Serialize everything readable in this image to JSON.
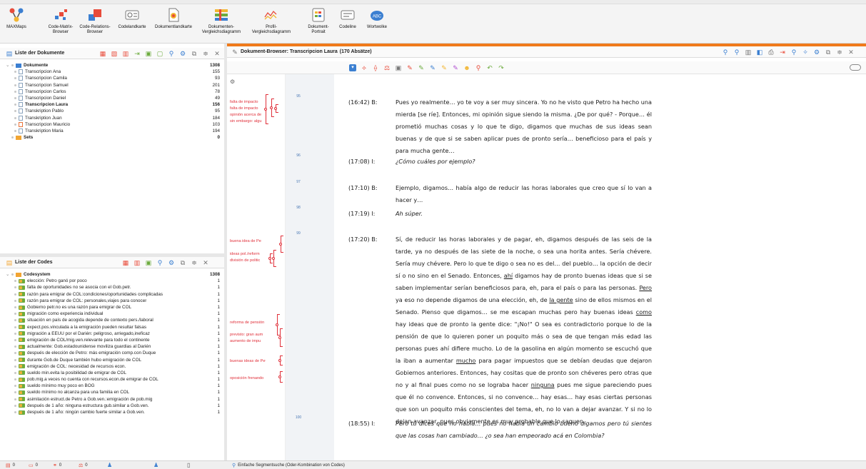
{
  "ribbon": {
    "buttons": [
      {
        "label": "MAXMaps",
        "icon": "maxmaps-icon"
      },
      {
        "label": "Code-Matrix-\nBrowser",
        "icon": "code-matrix-browser-icon"
      },
      {
        "label": "Code-Relations-\nBrowser",
        "icon": "code-relations-browser-icon"
      },
      {
        "label": "Codelandkarte",
        "icon": "codelandkarte-icon"
      },
      {
        "label": "Dokumentlandkarte",
        "icon": "dokumentlandkarte-icon"
      },
      {
        "label": "Dokumenten-\nVergleichsdiagramm",
        "icon": "dokumenten-vergleichsdiagramm-icon"
      },
      {
        "label": "Profil-\nVergleichsdiagramm",
        "icon": "profil-vergleichsdiagramm-icon"
      },
      {
        "label": "Dokument-\nPortrait",
        "icon": "dokument-portrait-icon"
      },
      {
        "label": "Codeline",
        "icon": "codeline-icon"
      },
      {
        "label": "Wortwolke",
        "icon": "wortwolke-icon"
      }
    ]
  },
  "docs_panel": {
    "title": "Liste der Dokumente",
    "root": {
      "label": "Dokumente",
      "count": "1308"
    },
    "items": [
      {
        "label": "Transcripcion Ana",
        "count": "155"
      },
      {
        "label": "Transcripcion Camila",
        "count": "93"
      },
      {
        "label": "Transcripcion Samuel",
        "count": "201"
      },
      {
        "label": "Transcripcion Carlos",
        "count": "78"
      },
      {
        "label": "Transcripcion Daniel",
        "count": "49"
      },
      {
        "label": "Transcripcion Laura",
        "count": "156"
      },
      {
        "label": "Transkription Pablo",
        "count": "95"
      },
      {
        "label": "Transkription Juan",
        "count": "184"
      },
      {
        "label": "Transcripcion Mauricio",
        "count": "103"
      },
      {
        "label": "Transkription Maria",
        "count": "194"
      }
    ],
    "sets": {
      "label": "Sets",
      "count": "0"
    }
  },
  "codes_panel": {
    "title": "Liste der Codes",
    "root": {
      "label": "Codesystem",
      "count": "1308"
    },
    "items": [
      {
        "label": "elección: Petro ganó por poco",
        "count": "1"
      },
      {
        "label": "falta de oportunidades no se asocia con el Gob.petr.",
        "count": "1"
      },
      {
        "label": "razón para emigrar de COL:condiciones/oportunidades complicadas",
        "count": "1"
      },
      {
        "label": "razón para emigrar de COL: personales,viajes para conocer",
        "count": "1"
      },
      {
        "label": "Gobierno petr.no es una razón para emigrar de COL",
        "count": "1"
      },
      {
        "label": "migración como experiencia individual",
        "count": "1"
      },
      {
        "label": "situación en país de acogida depende de contexto pers./laboral",
        "count": "1"
      },
      {
        "label": "expect.pos.vinculada a la emigración pueden resultar falsas",
        "count": "1"
      },
      {
        "label": "migración a EEUU por el Darién: peligroso, arriegado,ineficaz",
        "count": "1"
      },
      {
        "label": "emigración de COL/mig.ven.relevante para todo el continente",
        "count": "1"
      },
      {
        "label": "actualmente: Gob.estadounidense moviliza guardias al Darién",
        "count": "1"
      },
      {
        "label": "después de elección de Petro: más emigración comp.con Duque",
        "count": "1"
      },
      {
        "label": "durante Gob.de Duque también hubo emigración de COL",
        "count": "1"
      },
      {
        "label": "emigración de COL: necesidad de recursos econ.",
        "count": "1"
      },
      {
        "label": "sueldo min.evita la posibilidad de emigrar de COL",
        "count": "1"
      },
      {
        "label": "pob.mig.a veces no cuenta con recursos.econ.de emigrar de COL",
        "count": "1"
      },
      {
        "label": "sueldo mínimo muy poco en BOG",
        "count": "1"
      },
      {
        "label": "sueldo mínimo no alcanza para una familia en COL",
        "count": "1"
      },
      {
        "label": "asimilación estruct.de Petro a Gob.ven.:emigración de pob.mig",
        "count": "1"
      },
      {
        "label": "después de 1 año: ninguna estructura gub.similar a Gob.ven.",
        "count": "1"
      },
      {
        "label": "después de 1 año: ningún cambio fuerte similar a Gob.ven.",
        "count": "1"
      }
    ]
  },
  "browser": {
    "title": "Dokument-Browser: Transcripcion Laura",
    "count": "(170 Absätze)"
  },
  "code_labels": [
    {
      "text": "falta de impacto"
    },
    {
      "text": "falta de impacto"
    },
    {
      "text": "opinión acerca de"
    },
    {
      "text": "sin embargo: algu"
    },
    {
      "text": "buena idea de Pe"
    },
    {
      "text": "ideas pol./reform"
    },
    {
      "text": "división de politic"
    },
    {
      "text": "reforma de pensión"
    },
    {
      "text": "previsto: gran aum"
    },
    {
      "text": "aumento de impu"
    },
    {
      "text": "buenas ideas de Petro"
    },
    {
      "text": "oposición frenando"
    }
  ],
  "paragraphs": [
    {
      "num": "95",
      "ts": "(16:42) B:",
      "italic": false,
      "text": "Pues yo realmente… yo te voy a ser muy sincera. Yo no he visto que Petro ha hecho una mierda [se ríe]. Entonces, mi opinión sigue siendo la misma. ¿De por qué? - Porque… él prometió muchas cosas y lo que te digo, digamos que muchas de sus ideas sean buenas y de que si se saben aplicar pues de pronto sería… beneficioso para el país y para mucha gente…"
    },
    {
      "num": "96",
      "ts": "(17:08) I:",
      "italic": true,
      "text": "¿Cómo cuáles por ejemplo?"
    },
    {
      "num": "97",
      "ts": "(17:10) B:",
      "italic": false,
      "text": "Ejemplo, digamos… había algo de reducir las horas laborales que creo que sí lo van a hacer y…"
    },
    {
      "num": "98",
      "ts": "(17:19) I:",
      "italic": true,
      "text": "Ah súper."
    },
    {
      "num": "99",
      "ts": "(17:20) B:",
      "italic": false,
      "t1": "Sí, de reducir las horas laborales y de pagar, eh, digamos después de las seis de la tarde, ya no después de las siete de la noche, o sea una horita antes. Sería chévere. Sería muy chévere. Pero lo que te digo o sea no es del… del pueblo… la opción de decir sí o no sino en el Senado. Entonces, ",
      "u1": "ahí",
      "t2": " digamos hay de pronto buenas ideas que si se saben implementar serían beneficiosos para, eh, para el país o para las personas. ",
      "u2": "Pero",
      "t3": " ya eso no depende digamos de una elección, eh, de ",
      "u3": "la gente",
      "t4": " sino de ellos mismos en el Senado. Pienso que digamos… se me escapan muchas pero hay buenas ideas ",
      "u4": "como",
      "t5": " hay ideas que de pronto la gente dice: \"¡No!\" O sea es contradictorio porque lo de la pensión de que lo quieren poner un poquito más o sea de que tengan más edad las personas pues ahí difiere mucho. Lo de la gasolina en algún momento se escuchó que la iban a aumentar ",
      "u5": "mucho",
      "t6": " para pagar impuestos que se debían deudas que dejaron Gobiernos anteriores. Entonces, hay cositas que de pronto son chéveres pero otras que no y al final pues como no se lograba hacer ",
      "u6": "ninguna",
      "t7": " pues me sigue pareciendo pues que él no convence. Entonces, si no convence… hay esas… hay esas ciertas personas que son un poquito más conscientes del tema, eh, no lo van a dejar avanzar. Y si no lo dejan avanzar, pues obviamente es muy probable que lo saquen."
    },
    {
      "num": "100",
      "ts": "(18:55) I:",
      "italic": true,
      "text": "Pero tú dices que no había… pues no había un cambio bueno digamos pero tú sientes que las cosas han cambiado… ¿o sea han empeorado acá en Colombia?"
    }
  ],
  "status": {
    "s1": "0",
    "s2": "0",
    "s3": "0",
    "s4": "0",
    "search_label": "Einfache Segmentsuche (Oder-Kombination von Codes)"
  },
  "colors": {
    "accent": "#f07a1a",
    "code_red": "#e0303a",
    "code_green": "#6cab3d"
  }
}
